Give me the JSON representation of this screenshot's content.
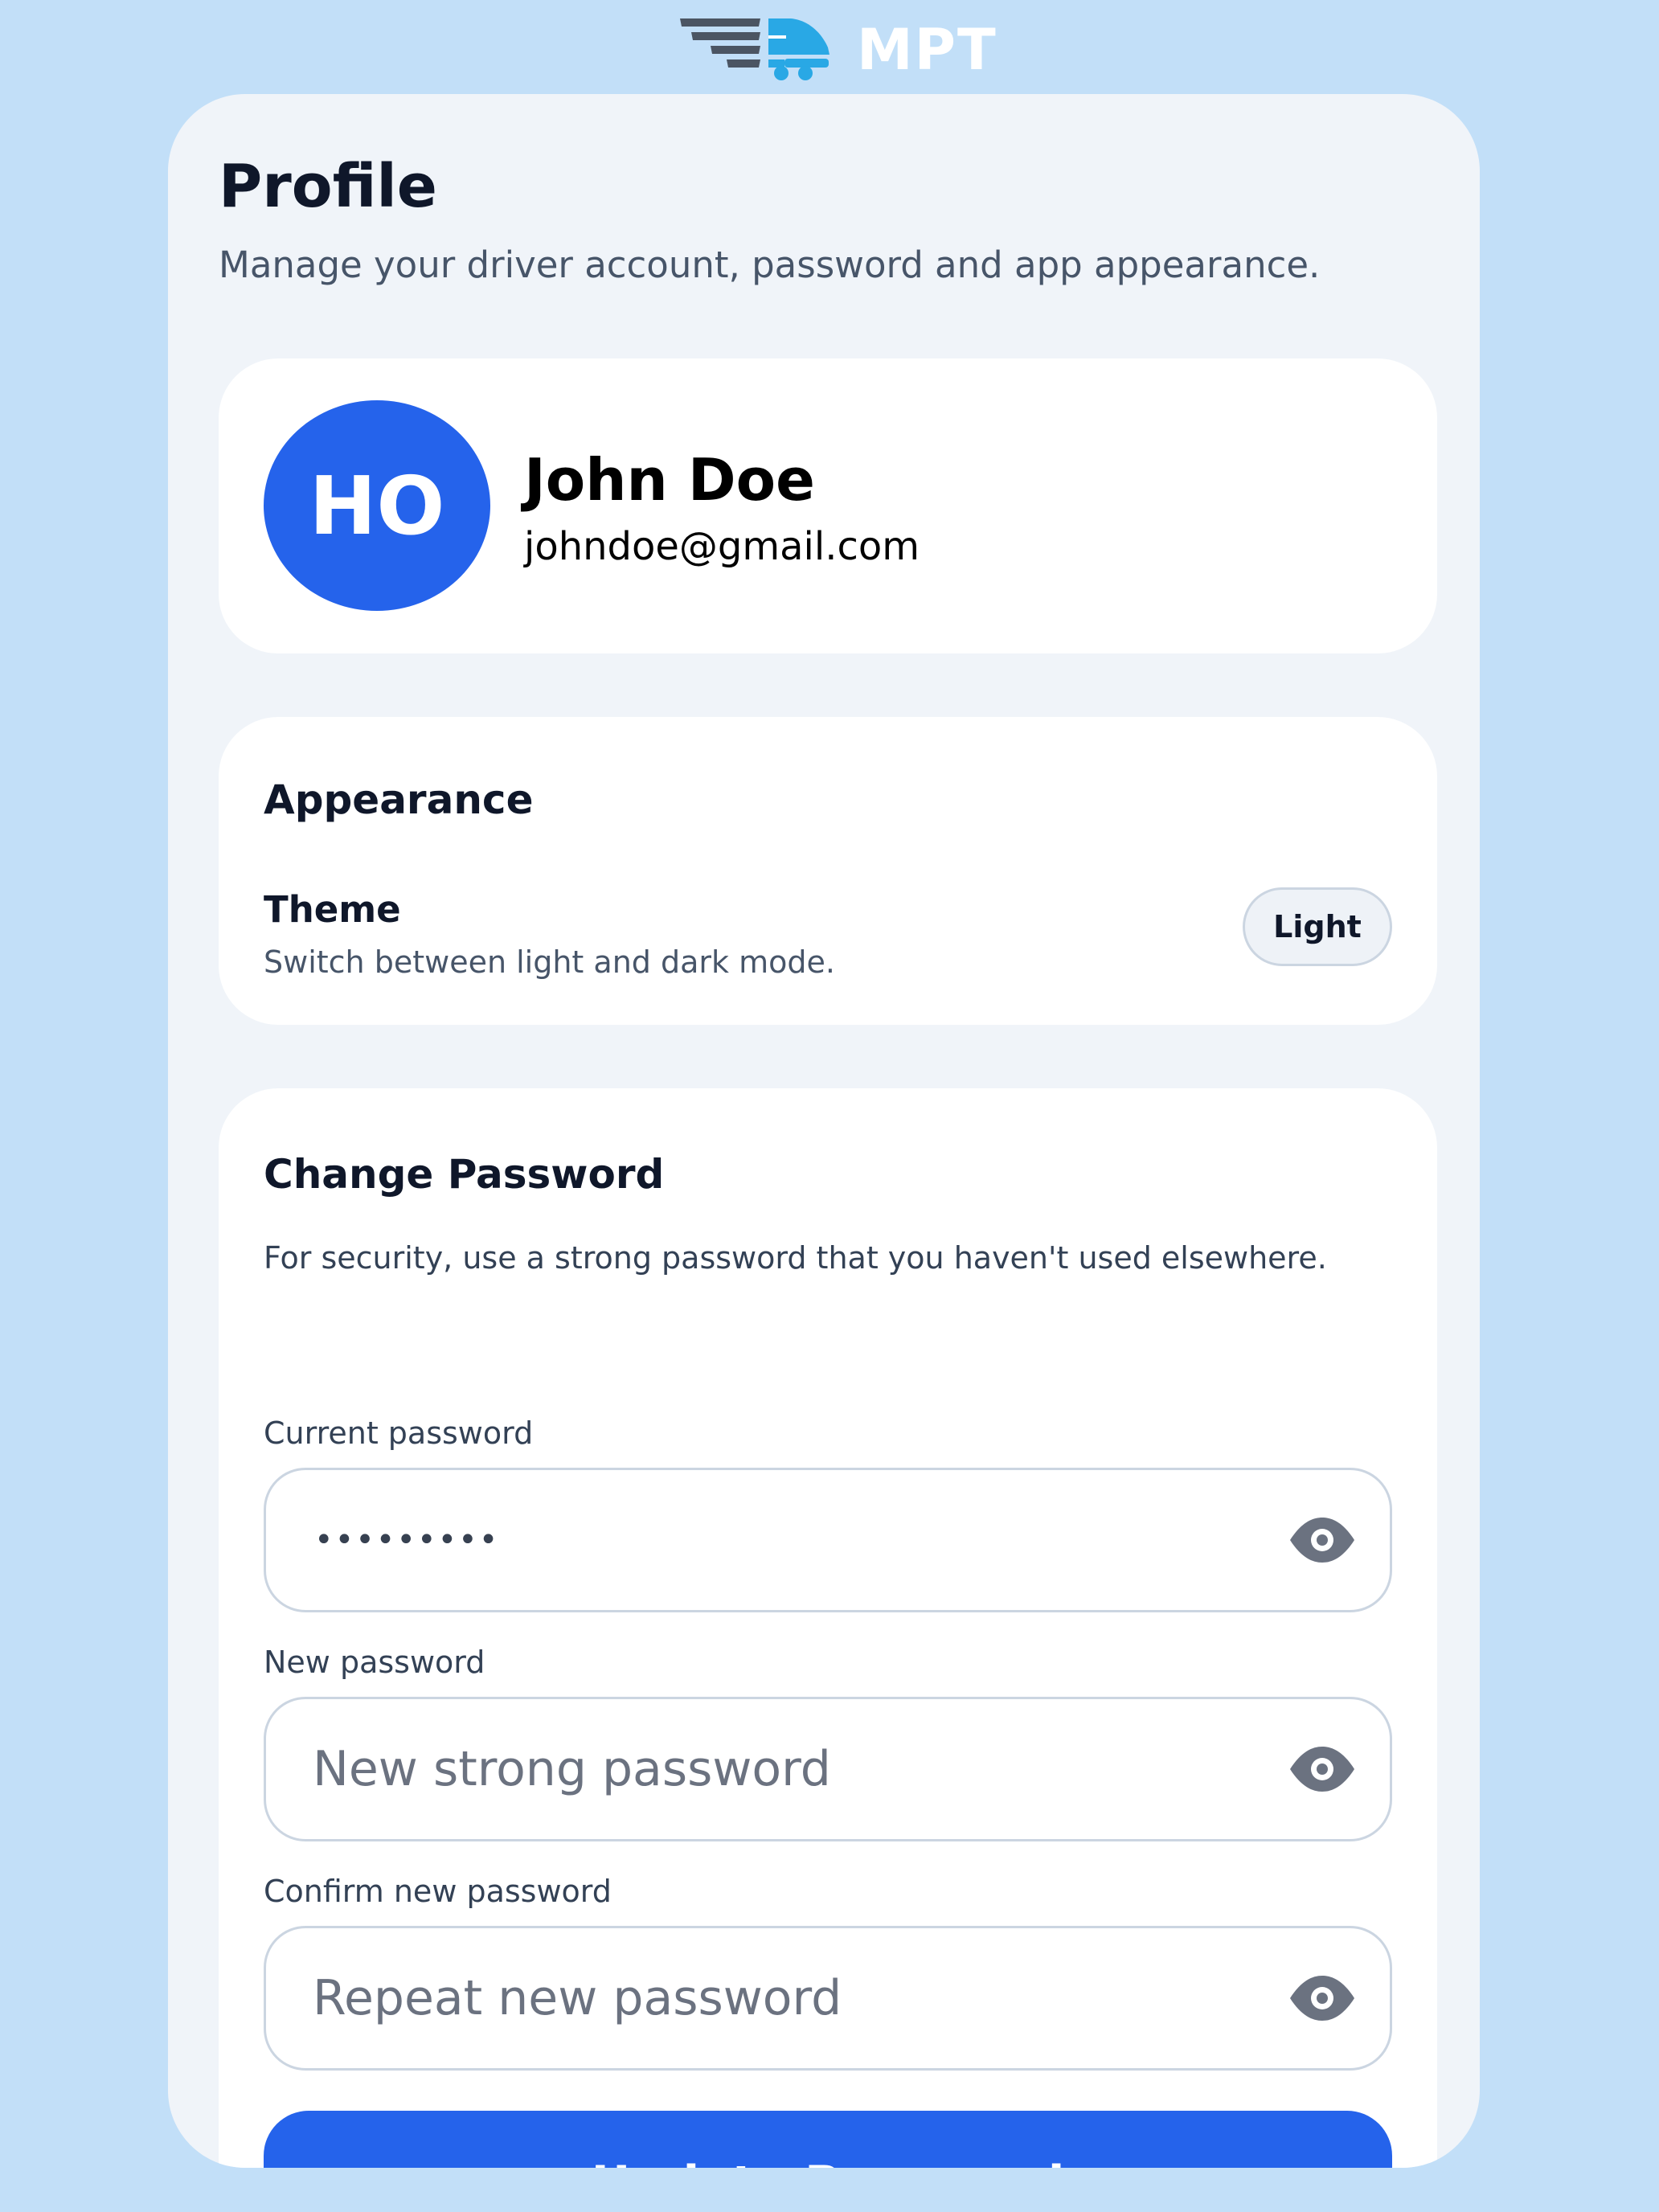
{
  "brand": {
    "name": "MPT",
    "colors": {
      "dark": "#4b5563",
      "accent": "#29a8e5"
    }
  },
  "header": {
    "title": "Profile",
    "subtitle": "Manage your driver account, password and app appearance."
  },
  "profile": {
    "initials": "HO",
    "name": "John Doe",
    "email": "johndoe@gmail.com",
    "avatar_color": "#2563eb"
  },
  "appearance": {
    "title": "Appearance",
    "theme_label": "Theme",
    "theme_description": "Switch between light and dark mode.",
    "theme_value": "Light"
  },
  "password": {
    "title": "Change Password",
    "description": "For security, use a strong password that you haven't used elsewhere.",
    "current": {
      "label": "Current password",
      "masked_value": "•••••••••",
      "icon": "eye-icon"
    },
    "new": {
      "label": "New password",
      "placeholder": "New strong password",
      "icon": "eye-icon"
    },
    "confirm": {
      "label": "Confirm new password",
      "placeholder": "Repeat new password",
      "icon": "eye-icon"
    },
    "submit_label": "Update Password"
  },
  "colors": {
    "background": "#c2dff8",
    "panel": "#f0f4f9",
    "card": "#ffffff",
    "primary": "#2563eb",
    "text": "#0f172a",
    "muted": "#475569"
  }
}
